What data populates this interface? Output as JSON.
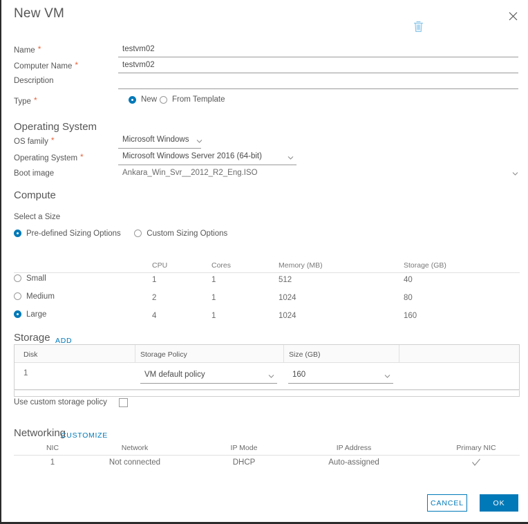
{
  "window": {
    "title": "New VM",
    "close_icon": "close-icon"
  },
  "form": {
    "name": {
      "label": "Name",
      "required": "*",
      "value": "testvm02",
      "placeholder": ""
    },
    "computer_name": {
      "label": "Computer Name",
      "required": "*",
      "value": "testvm02",
      "placeholder": ""
    },
    "description": {
      "label": "Description",
      "value": "",
      "placeholder": ""
    },
    "type": {
      "label": "Type",
      "required": "*",
      "options": [
        {
          "label": "New",
          "selected": true
        },
        {
          "label": "From Template",
          "selected": false
        }
      ]
    }
  },
  "operating_system": {
    "heading": "Operating System",
    "os_family": {
      "label": "OS family",
      "required": "*",
      "value": "Microsoft Windows"
    },
    "operating_system": {
      "label": "Operating System",
      "required": "*",
      "value": "Microsoft Windows Server 2016 (64-bit)"
    },
    "boot_image": {
      "label": "Boot image",
      "value": "Ankara_Win_Svr__2012_R2_Eng.ISO"
    }
  },
  "compute": {
    "heading": "Compute",
    "select_size_label": "Select a Size",
    "sizing_mode": [
      {
        "label": "Pre-defined Sizing Options",
        "selected": true
      },
      {
        "label": "Custom Sizing Options",
        "selected": false
      }
    ],
    "size_table": {
      "columns": [
        "",
        "CPU",
        "Cores",
        "Memory (MB)",
        "Storage (GB)"
      ],
      "rows": [
        {
          "name": "Small",
          "cpu": "1",
          "cores": "1",
          "memory": "512",
          "storage": "40",
          "selected": false
        },
        {
          "name": "Medium",
          "cpu": "2",
          "cores": "1",
          "memory": "1024",
          "storage": "80",
          "selected": false
        },
        {
          "name": "Large",
          "cpu": "4",
          "cores": "1",
          "memory": "1024",
          "storage": "160",
          "selected": true
        }
      ]
    }
  },
  "storage": {
    "heading": "Storage",
    "add_label": "ADD",
    "columns": [
      "Disk",
      "Storage Policy",
      "Size (GB)",
      ""
    ],
    "rows": [
      {
        "disk": "1",
        "policy": "VM default policy",
        "size": "160",
        "delete_icon": "trash-icon"
      }
    ],
    "custom_policy_label": "Use custom storage policy",
    "custom_policy_checked": false
  },
  "networking": {
    "heading": "Networking",
    "customize_label": "CUSTOMIZE",
    "columns": [
      "NIC",
      "Network",
      "IP Mode",
      "IP Address",
      "Primary NIC"
    ],
    "rows": [
      {
        "nic": "1",
        "network": "Not connected",
        "ip_mode": "DHCP",
        "ip_address": "Auto-assigned",
        "primary": true
      }
    ]
  },
  "footer": {
    "cancel_label": "CANCEL",
    "ok_label": "OK"
  },
  "colors": {
    "accent": "#0079b8",
    "required": "#e8643c",
    "text": "#565656",
    "muted": "#6a6a6a"
  }
}
